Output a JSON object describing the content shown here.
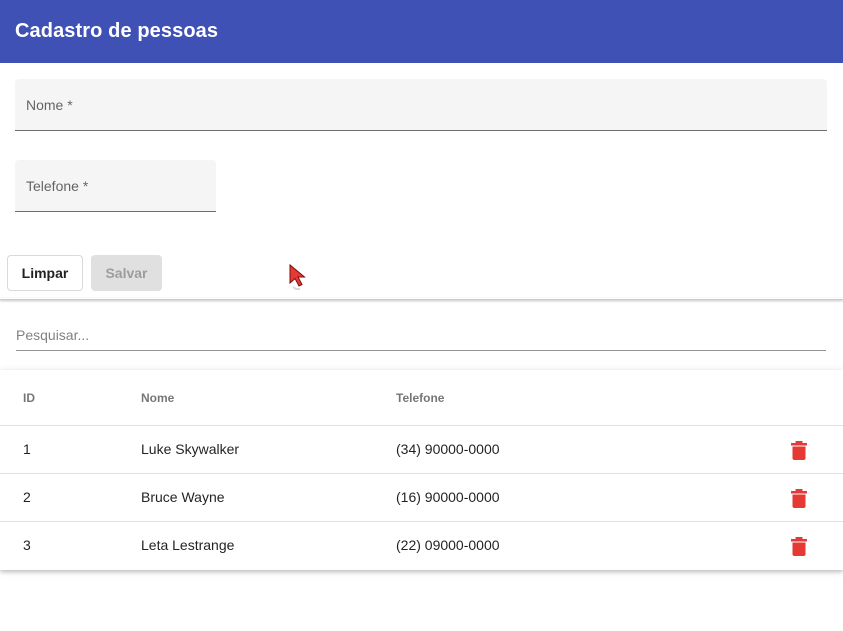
{
  "app": {
    "title": "Cadastro de pessoas"
  },
  "form": {
    "nome_label": "Nome *",
    "nome_value": "",
    "telefone_label": "Telefone *",
    "telefone_value": "",
    "limpar_label": "Limpar",
    "salvar_label": "Salvar"
  },
  "search": {
    "placeholder": "Pesquisar...",
    "value": ""
  },
  "table": {
    "headers": {
      "id": "ID",
      "nome": "Nome",
      "telefone": "Telefone"
    },
    "rows": [
      {
        "id": "1",
        "nome": "Luke Skywalker",
        "telefone": "(34) 90000-0000",
        "action_icon": "trash-icon"
      },
      {
        "id": "2",
        "nome": "Bruce Wayne",
        "telefone": "(16) 90000-0000",
        "action_icon": "trash-icon"
      },
      {
        "id": "3",
        "nome": "Leta Lestrange",
        "telefone": "(22) 09000-0000",
        "action_icon": "trash-icon"
      }
    ]
  },
  "colors": {
    "primary": "#3f51b5",
    "danger": "#e53935"
  }
}
